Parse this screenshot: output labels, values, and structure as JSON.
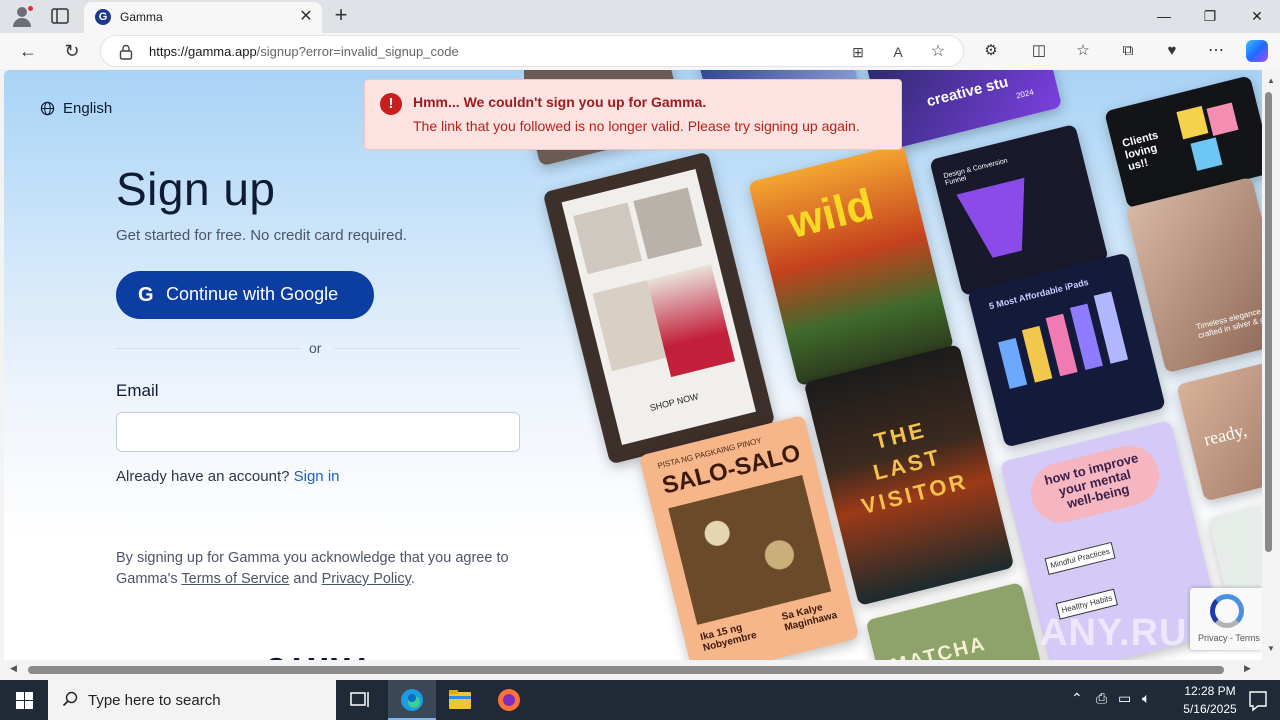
{
  "browser": {
    "tab_title": "Gamma",
    "tab_favicon_letter": "G",
    "new_tab": "+",
    "url_host": "https://gamma.app",
    "url_rest": "/signup?error=invalid_signup_code",
    "minimize": "—",
    "restore": "❐",
    "close": "✕"
  },
  "page": {
    "language": "English",
    "title": "Sign up",
    "subtitle": "Get started for free. No credit card required.",
    "google_button": "Continue with Google",
    "google_icon_letter": "G",
    "divider": "or",
    "email_label": "Email",
    "email_value": "",
    "already_text": "Already have an account?",
    "sign_in": "Sign in",
    "legal_prefix": "By signing up for Gamma you acknowledge that you agree to Gamma's",
    "terms": "Terms of Service",
    "and": "and",
    "privacy": "Privacy Policy",
    "period": ".",
    "footer_logo": "GAMMA"
  },
  "toast": {
    "title": "Hmm... We couldn't sign you up for Gamma.",
    "message": "The link that you followed is no longer valid. Please try signing up again."
  },
  "collage": {
    "card_creative": "creative stu",
    "card_creative_year": "2024",
    "card_clients": "Clients loving us!!",
    "card_funnel": "Design & Conversion Funnel",
    "card_wild": "wild",
    "card_ipads": "5 Most Affordable iPads",
    "card_timeless": "Timeless elegance, crafted in silver & gold",
    "card_shop": "SHOP NOW",
    "card_lastvisitor": "THE LAST VISITOR",
    "card_pista": "PISTA NG PAGKAING PINOY",
    "card_salo": "SALO-SALO",
    "card_ika": "Ika 15 ng Nobyembre",
    "card_kalye": "Sa Kalye Maginhawa",
    "card_mental": "how to improve your mental well-being",
    "card_mindful": "Mindful Practices",
    "card_healthy": "Healthy Habits",
    "card_ready": "ready,",
    "card_matcha": "MATCHA"
  },
  "recaptcha": {
    "text": "Privacy - Terms"
  },
  "watermark": "ANY.RUN",
  "taskbar": {
    "search_placeholder": "Type here to search",
    "time": "12:28 PM",
    "date": "5/16/2025"
  },
  "colors": {
    "primary_button": "#0c3da1",
    "error_bg": "#fde2e2",
    "error_text": "#b42318",
    "link": "#1a5cc8"
  }
}
